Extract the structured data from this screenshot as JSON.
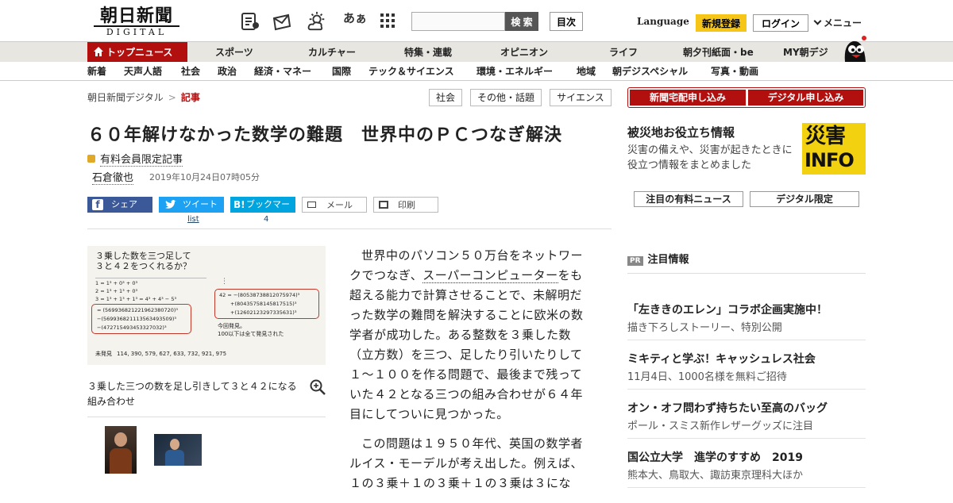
{
  "header": {
    "logo_jp": "朝日新聞",
    "logo_en": "DIGITAL",
    "icons": [
      "news-icon",
      "mail-icon",
      "weather-icon",
      "font-size-icon",
      "grid-icon"
    ],
    "font_icon_text": "あぁ",
    "search_placeholder": "",
    "search_button": "検 索",
    "index_button": "目次",
    "language": "Language",
    "register": "新規登録",
    "login": "ログイン",
    "menu": "メニュー"
  },
  "nav1": {
    "top_news": "トップニュース",
    "items": [
      "スポーツ",
      "カルチャー",
      "特集・連載",
      "オピニオン",
      "ライフ",
      "朝夕刊紙面・be",
      "MY朝デジ"
    ]
  },
  "nav2": {
    "items": [
      "新着",
      "天声人語",
      "社会",
      "政治",
      "経済・マネー",
      "国際",
      "テック＆サイエンス",
      "環境・エネルギー",
      "地域",
      "朝デジスペシャル",
      "写真・動画"
    ]
  },
  "breadcrumb": {
    "home": "朝日新聞デジタル",
    "sep": ">",
    "current": "記事"
  },
  "tags": [
    "社会",
    "その他・話題",
    "サイエンス"
  ],
  "article": {
    "title": "６０年解けなかった数学の難題　世界中のＰＣつなぎ解決",
    "members_only": "有料会員限定記事",
    "author": "石倉徹也",
    "date": "2019年10月24日07時05分"
  },
  "share": {
    "share": "シェア",
    "tweet": "ツイート",
    "tweet_count": "list",
    "bookmark": "ブックマーク",
    "bookmark_count": "4",
    "mail": "メール",
    "print": "印刷"
  },
  "figure": {
    "question": "３乗した数を三つ足して\n３と４２をつくれるか？",
    "eq1": "1 = 1³ + 0³ + 0³",
    "eq2": "2 = 1³ + 1³ + 0³",
    "eq3": "3 = 1³ + 1³ + 1³ = 4³ + 4³ − 5³",
    "eq3a": "= (569936821221962380720)³",
    "eq3b": "−(569936821113563493509)³",
    "eq3c": "−(472715493453327032)³",
    "eq42a": "42 = −(80538738812075974)³",
    "eq42b": "+(80435758145817515)³",
    "eq42c": "+(12602123297335631)³",
    "found1": "今回発見。",
    "found2": "100以下は全て発見された",
    "unfound_label": "未発見",
    "unfound": "114, 390, 579, 627, 633, 732, 921, 975",
    "dots": "⋮",
    "caption": "３乗した三つの数を足し引きして３と４２になる組み合わせ"
  },
  "body": {
    "p1_a": "世界中のパソコン５０万台をネットワークでつなぎ、",
    "p1_kw": "スーパーコンピューター",
    "p1_b": "をも超える能力で計算させることで、未解明だった数学の難問を解決することに欧米の数学者が成功した。ある整数を３乗した数（立方数）を三つ、足したり引いたりして１～１００を作る問題で、最後まで残っていた４２となる三つの組み合わせが６４年目にしてついに見つかった。",
    "p2": "この問題は１９５０年代、英国の数学者ルイス・モーデルが考え出した。例えば、１の３乗＋１の３乗＋１の３乗は３にな"
  },
  "sidebar": {
    "order_newspaper": "新聞宅配申し込み",
    "order_digital": "デジタル申し込み",
    "disaster_title": "被災地お役立ち情報",
    "disaster_text": "災害の備えや、災害が起きたときに役立つ情報をまとめました",
    "disaster_logo_1": "災害",
    "disaster_logo_2": "INFO",
    "tab_paid": "注目の有料ニュース",
    "tab_digital": "デジタル限定",
    "pr_badge": "PR",
    "pr_head": "注目情報",
    "pr_items": [
      {
        "title": "「左ききのエレン」コラボ企画実施中！",
        "sub": "描き下ろしストーリー、特別公開"
      },
      {
        "title": "ミキティと学ぶ！キャッシュレス社会",
        "sub": "11月4日、1000名様を無料ご招待"
      },
      {
        "title": "オン・オフ問わず持ちたい至高のバッグ",
        "sub": "ポール・スミス新作レザーグッズに注目"
      },
      {
        "title": "国公立大学　進学のすすめ　2019",
        "sub": "熊本大、鳥取大、諏訪東京理科大ほか"
      }
    ]
  },
  "colors": {
    "brand_red": "#b20f0f",
    "register_yellow": "#f5c518",
    "facebook": "#3b5998",
    "twitter": "#1da1f2",
    "hatena": "#00a4de"
  }
}
